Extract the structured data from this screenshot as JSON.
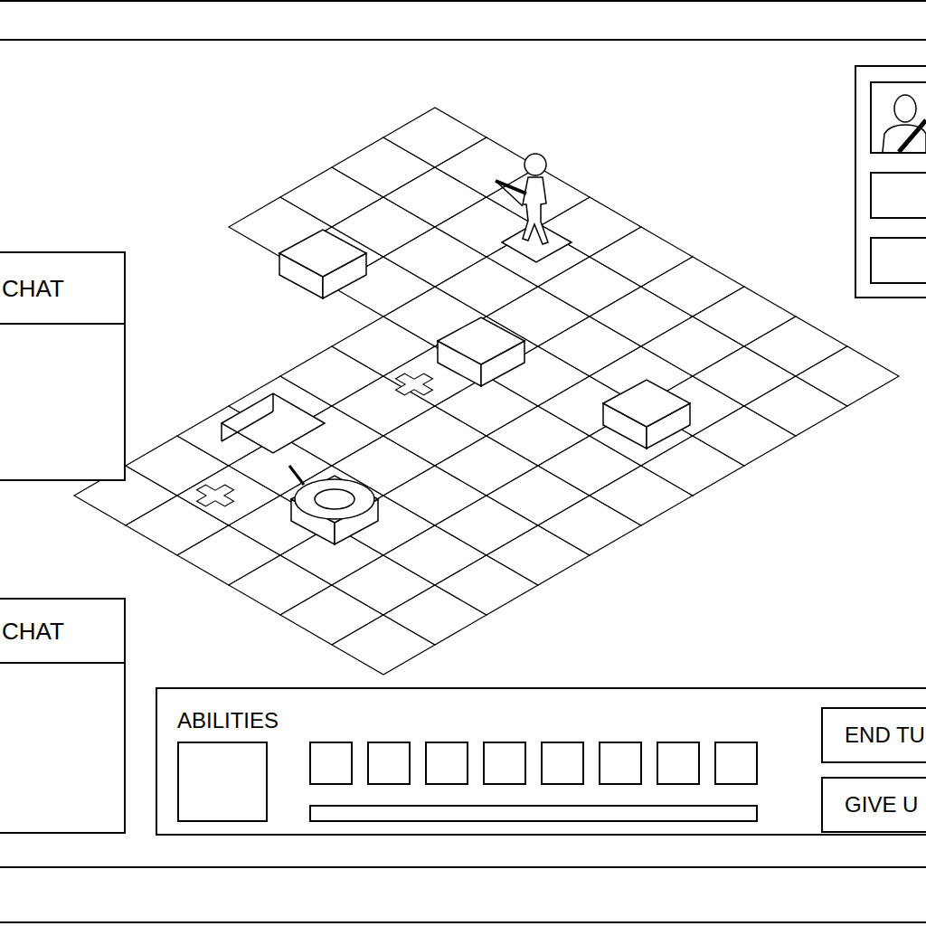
{
  "chat_panels": [
    {
      "title": "CHAT"
    },
    {
      "title": "CHAT"
    }
  ],
  "portrait_panel": {
    "info_boxes": [
      {
        "empty": true
      },
      {
        "empty": true
      }
    ]
  },
  "abilities": {
    "title": "ABILITIES",
    "main_slot": {
      "empty": true
    },
    "slots": [
      {
        "empty": true
      },
      {
        "empty": true
      },
      {
        "empty": true
      },
      {
        "empty": true
      },
      {
        "empty": true
      },
      {
        "empty": true
      },
      {
        "empty": true
      },
      {
        "empty": true
      }
    ],
    "bar": {
      "level": 0
    }
  },
  "buttons": [
    {
      "label": "END TU"
    },
    {
      "label": "GIVE U"
    }
  ]
}
